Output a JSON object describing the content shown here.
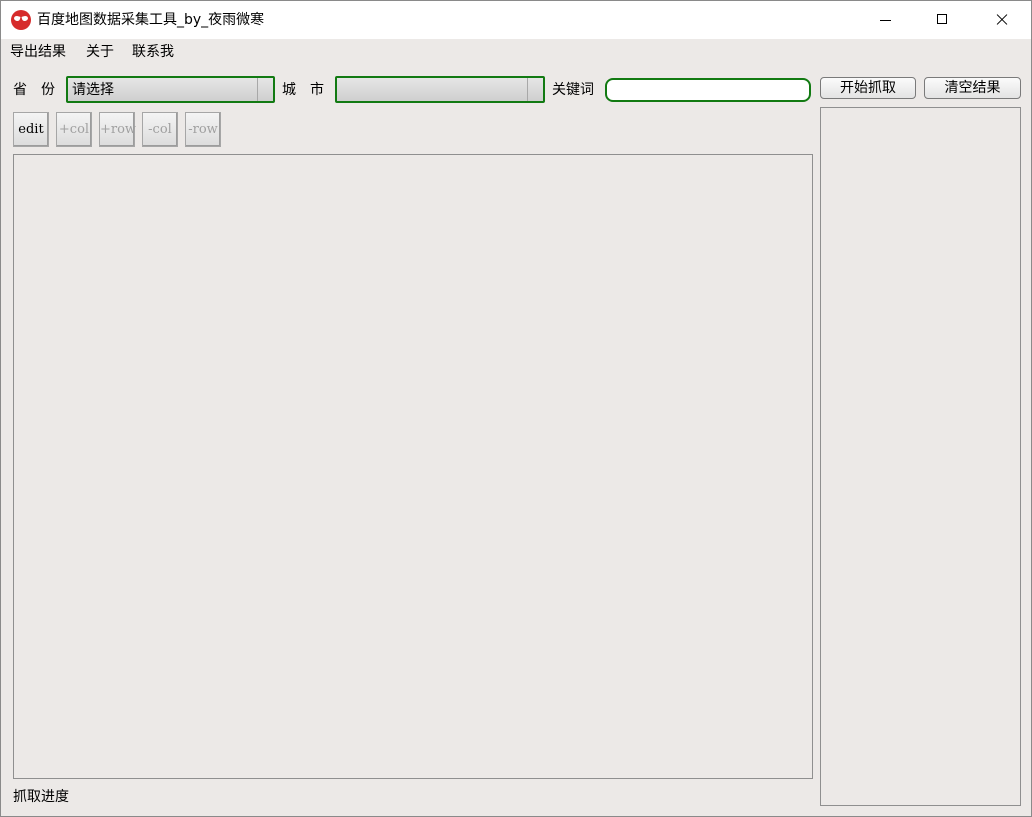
{
  "window": {
    "title": "百度地图数据采集工具_by_夜雨微寒",
    "app_icon": "spider-mask-icon",
    "controls": {
      "minimize": "minimize-icon",
      "maximize": "maximize-icon",
      "close": "close-icon"
    }
  },
  "menu": {
    "export": "导出结果",
    "about": "关于",
    "contact": "联系我"
  },
  "form": {
    "province_label": "省　份",
    "province_value": "请选择",
    "city_label": "城　市",
    "city_value": "",
    "keyword_label": "关键词",
    "keyword_value": "",
    "start_button": "开始抓取",
    "clear_button": "清空结果"
  },
  "toolbar": {
    "edit": "edit",
    "add_col": "+col",
    "add_row": "+row",
    "del_col": "-col",
    "del_row": "-row"
  },
  "status": {
    "progress_label": "抓取进度"
  },
  "colors": {
    "accent_border": "#127a12",
    "background": "#ece9e7"
  }
}
